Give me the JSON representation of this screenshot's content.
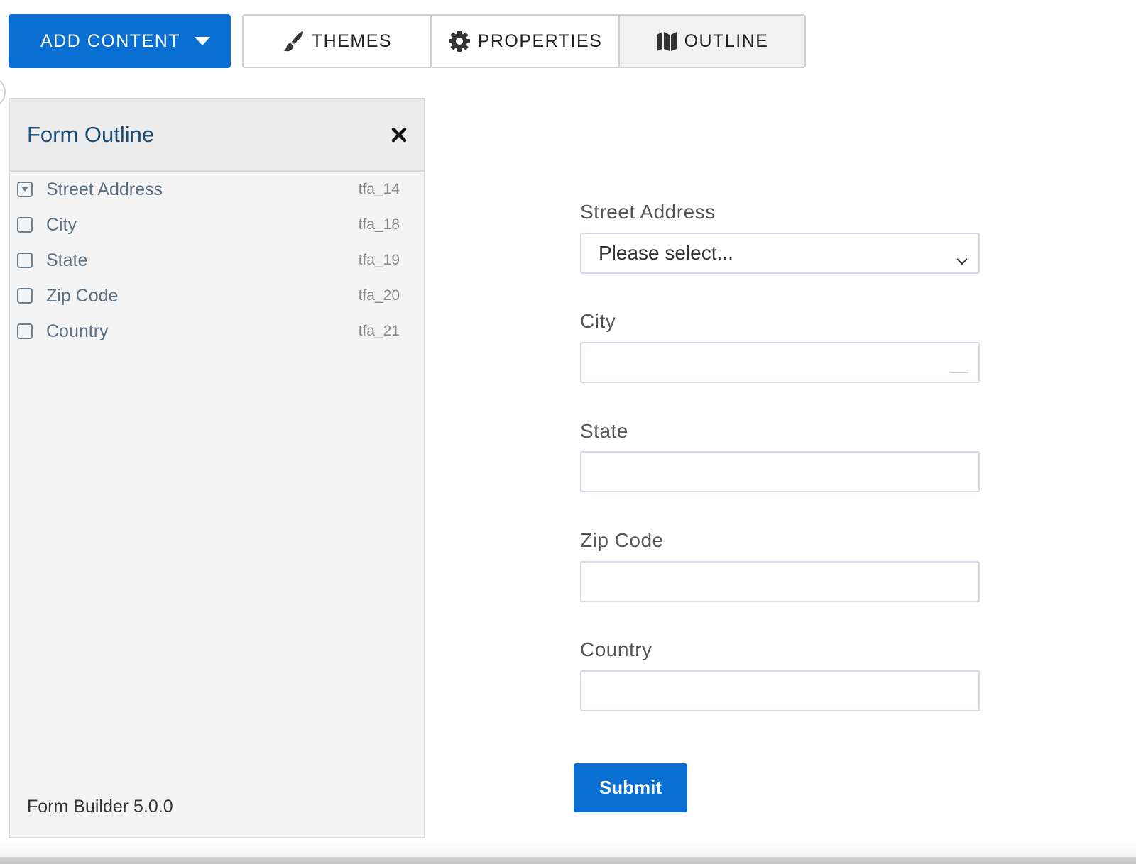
{
  "toolbar": {
    "add_content": {
      "label": "ADD CONTENT",
      "caret_icon": "caret-down-icon"
    },
    "tabs": [
      {
        "label": "THEMES",
        "icon": "paintbrush-icon",
        "active": false
      },
      {
        "label": "PROPERTIES",
        "icon": "gear-icon",
        "active": false
      },
      {
        "label": "OUTLINE",
        "icon": "map-icon",
        "active": true
      }
    ]
  },
  "outline_panel": {
    "title": "Form Outline",
    "close_icon": "close-icon",
    "items": [
      {
        "label": "Street Address",
        "id": "tfa_14",
        "type": "select"
      },
      {
        "label": "City",
        "id": "tfa_18",
        "type": "text"
      },
      {
        "label": "State",
        "id": "tfa_19",
        "type": "text"
      },
      {
        "label": "Zip Code",
        "id": "tfa_20",
        "type": "text"
      },
      {
        "label": "Country",
        "id": "tfa_21",
        "type": "text"
      }
    ],
    "footer": "Form Builder 5.0.0"
  },
  "form": {
    "fields": [
      {
        "label": "Street Address",
        "placeholder": "Please select...",
        "value": ""
      },
      {
        "label": "City",
        "value": ""
      },
      {
        "label": "State",
        "value": ""
      },
      {
        "label": "Zip Code",
        "value": ""
      },
      {
        "label": "Country",
        "value": ""
      }
    ],
    "submit_label": "Submit"
  },
  "colors": {
    "primary": "#0a6fd2",
    "panel_title": "#1e4f78",
    "outline_label": "#5b6f80",
    "field_border": "#d9d7ea"
  }
}
